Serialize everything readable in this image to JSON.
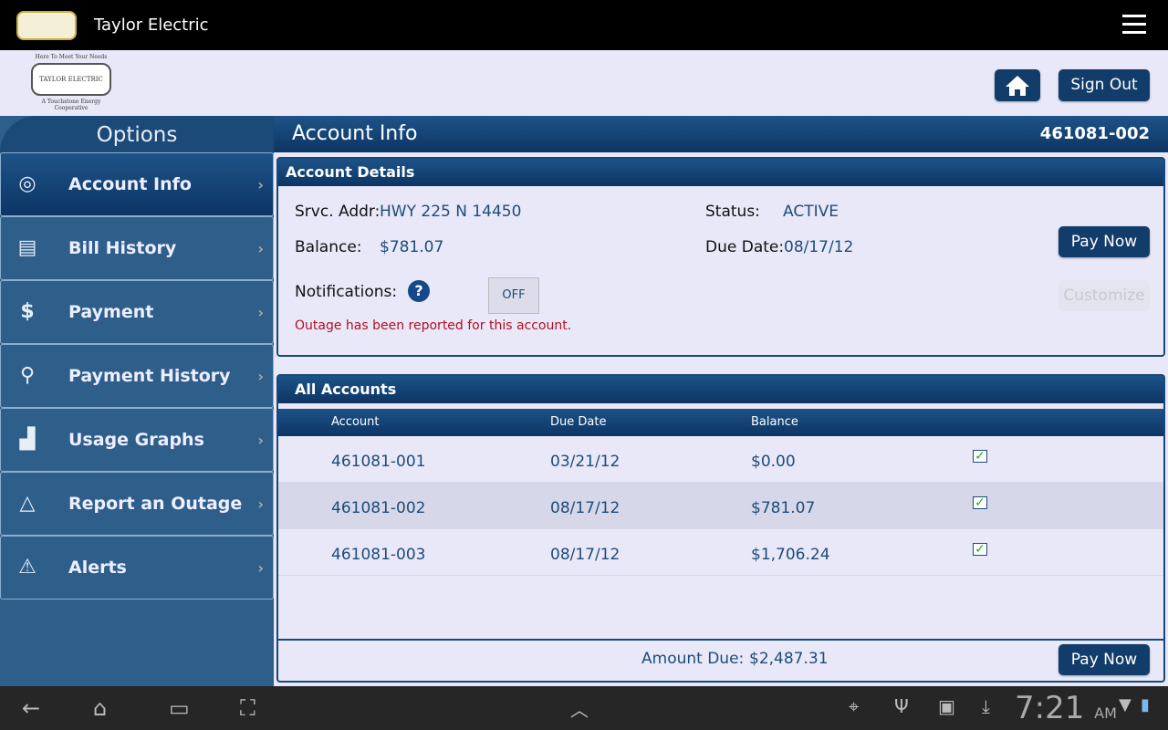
{
  "app": {
    "title": "Taylor Electric",
    "logo": "TAYLOR ELECTRIC Cooperative Inc"
  },
  "header": {
    "logo_tagline": "Here To Meet Your Needs",
    "logo_name": "TAYLOR ELECTRIC",
    "logo_sub": "A Touchstone Energy Cooperative",
    "home_icon": "home-icon",
    "sign_out": "Sign Out"
  },
  "sidebar": {
    "title": "Options",
    "items": [
      {
        "label": "Account Info",
        "icon": "user-icon"
      },
      {
        "label": "Bill History",
        "icon": "bill-icon"
      },
      {
        "label": "Payment",
        "icon": "dollar-icon"
      },
      {
        "label": "Payment History",
        "icon": "search-money-icon"
      },
      {
        "label": "Usage Graphs",
        "icon": "chart-icon"
      },
      {
        "label": "Report an Outage",
        "icon": "lightning-warning-icon"
      },
      {
        "label": "Alerts",
        "icon": "alert-icon"
      }
    ]
  },
  "main": {
    "title": "Account Info",
    "account_number": "461081-002"
  },
  "details": {
    "title": "Account Details",
    "srvc_label": "Srvc. Addr:",
    "srvc_value": "HWY 225 N 14450",
    "status_label": "Status:",
    "status_value": "ACTIVE",
    "balance_label": "Balance:",
    "balance_value": "$781.07",
    "due_label": "Due Date:",
    "due_value": "08/17/12",
    "pay_now": "Pay Now",
    "notifications_label": "Notifications:",
    "toggle": "OFF",
    "customize": "Customize",
    "outage_msg": "Outage has been reported for this account."
  },
  "accounts": {
    "title": "All Accounts",
    "columns": [
      "Account",
      "Due Date",
      "Balance"
    ],
    "rows": [
      {
        "account": "461081-001",
        "due": "03/21/12",
        "balance": "$0.00",
        "checked": true
      },
      {
        "account": "461081-002",
        "due": "08/17/12",
        "balance": "$781.07",
        "checked": true
      },
      {
        "account": "461081-003",
        "due": "08/17/12",
        "balance": "$1,706.24",
        "checked": true
      }
    ],
    "amount_due_label": "Amount Due:",
    "amount_due": "$2,487.31",
    "pay_now": "Pay Now"
  },
  "system": {
    "time": "7:21",
    "ampm": "AM"
  },
  "colors": {
    "brand": "#123c6a",
    "sidebar": "#2e5e8a",
    "warning": "#b01020"
  }
}
